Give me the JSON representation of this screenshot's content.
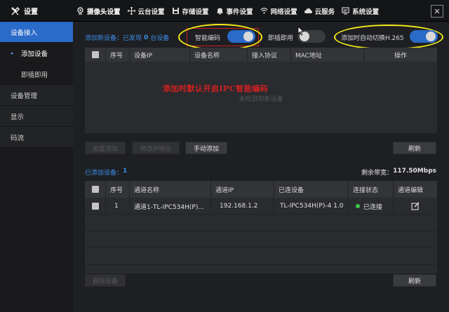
{
  "app": {
    "title": "设置"
  },
  "nav": [
    {
      "label": "摄像头设置",
      "icon": "camera-icon"
    },
    {
      "label": "云台设置",
      "icon": "ptz-icon"
    },
    {
      "label": "存储设置",
      "icon": "storage-icon"
    },
    {
      "label": "事件设置",
      "icon": "bell-icon"
    },
    {
      "label": "网络设置",
      "icon": "wifi-icon"
    },
    {
      "label": "云服务",
      "icon": "cloud-icon"
    },
    {
      "label": "系统设置",
      "icon": "monitor-icon"
    }
  ],
  "sidebar": {
    "items": [
      {
        "label": "设备接入"
      },
      {
        "label": "添加设备"
      },
      {
        "label": "即插即用"
      },
      {
        "label": "设备管理"
      },
      {
        "label": "显示"
      },
      {
        "label": "码流"
      }
    ]
  },
  "add_section": {
    "title_prefix": "添加新设备：已发现",
    "found_count": "0",
    "title_suffix": "台设备",
    "smart_encode_label": "智能编码",
    "smart_encode_on": true,
    "plug_play_label": "即插即用",
    "plug_play_on": false,
    "auto_h265_label": "添加时自动切换H.265",
    "auto_h265_on": true,
    "columns": [
      "",
      "序号",
      "设备IP",
      "设备名称",
      "接入协议",
      "MAC地址",
      "操作"
    ],
    "empty_text": "未检测到新设备",
    "annotation": "添加时默认开启IPC智能编码",
    "buttons": {
      "batch_add": "批量添加",
      "modify_ip": "修改IP地址",
      "manual_add": "手动添加",
      "refresh": "刷新"
    }
  },
  "added_section": {
    "title_prefix": "已添加设备：",
    "count": "1",
    "bandwidth_label": "剩余带宽：",
    "bandwidth_value": "117.50Mbps",
    "columns": [
      "",
      "序号",
      "通道名称",
      "通道IP",
      "已连设备",
      "连接状态",
      "通道编辑"
    ],
    "rows": [
      {
        "index": "1",
        "channel_name": "通道1-TL-IPC534H(P)...",
        "channel_ip": "192.168.1.2",
        "device": "TL-IPC534H(P)-4 1.0",
        "status": "已连接"
      }
    ],
    "buttons": {
      "delete": "删除设备",
      "refresh": "刷新"
    }
  },
  "colors": {
    "accent": "#2a6ac8",
    "highlight": "#f4ec18",
    "annotation": "#d42020",
    "status_ok": "#3cc84a"
  }
}
